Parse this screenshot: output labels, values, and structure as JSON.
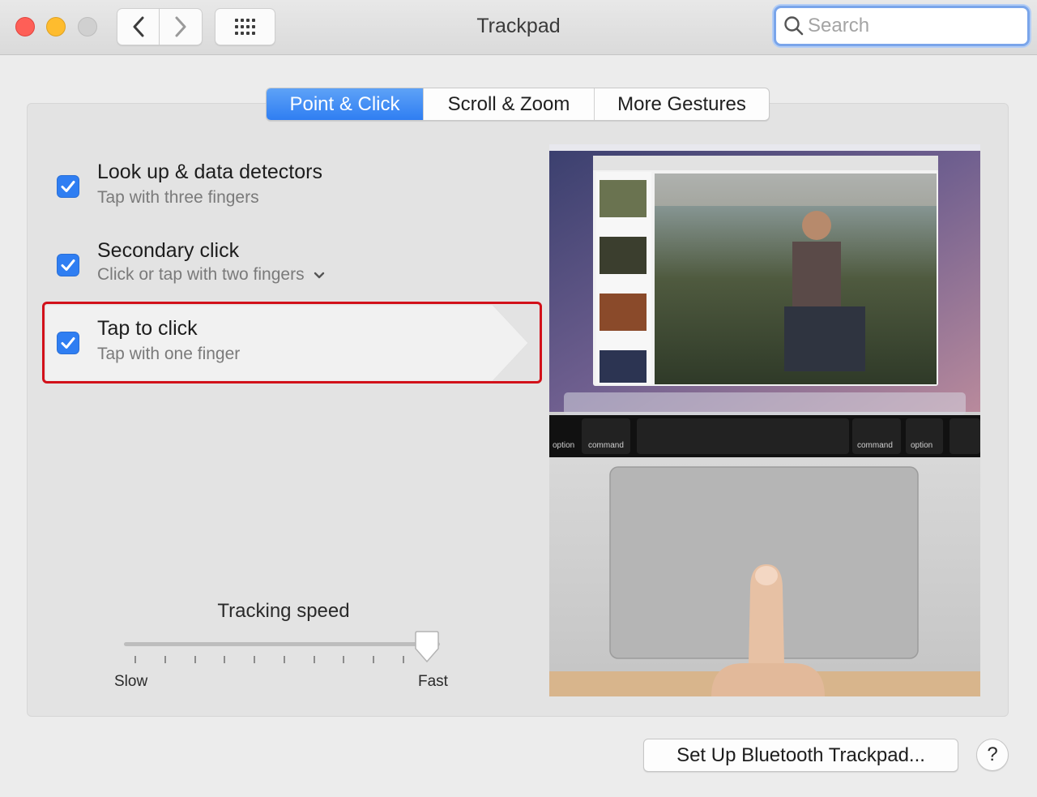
{
  "window": {
    "title": "Trackpad"
  },
  "search": {
    "placeholder": "Search",
    "value": ""
  },
  "tabs": [
    {
      "label": "Point & Click",
      "active": true
    },
    {
      "label": "Scroll & Zoom",
      "active": false
    },
    {
      "label": "More Gestures",
      "active": false
    }
  ],
  "options": [
    {
      "title": "Look up & data detectors",
      "subtitle": "Tap with three fingers",
      "checked": true
    },
    {
      "title": "Secondary click",
      "subtitle": "Click or tap with two fingers",
      "checked": true,
      "has_dropdown": true
    },
    {
      "title": "Tap to click",
      "subtitle": "Tap with one finger",
      "checked": true,
      "highlighted": true
    }
  ],
  "tracking": {
    "label": "Tracking speed",
    "min_label": "Slow",
    "max_label": "Fast",
    "value_fraction": 0.96,
    "ticks": 10
  },
  "preview": {
    "key_labels": {
      "left_option": "option",
      "left_command": "command",
      "right_command": "command",
      "right_option": "option"
    }
  },
  "footer": {
    "setup_button": "Set Up Bluetooth Trackpad...",
    "help_button": "?"
  },
  "colors": {
    "accent": "#2f7ef2",
    "highlight_border": "#d2111a"
  },
  "icons": [
    "back-chevron-icon",
    "forward-chevron-icon",
    "grid-icon",
    "search-icon",
    "checkmark-icon",
    "chevron-down-icon"
  ]
}
